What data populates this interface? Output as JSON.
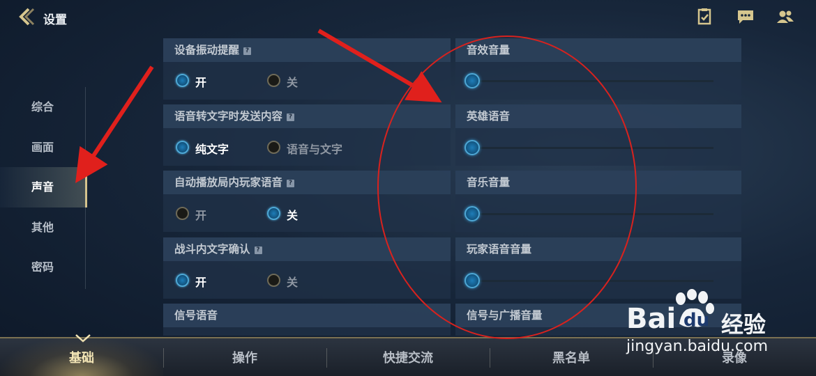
{
  "header": {
    "title": "设置"
  },
  "sidebar": {
    "items": [
      {
        "label": "综合"
      },
      {
        "label": "画面"
      },
      {
        "label": "声音"
      },
      {
        "label": "其他"
      },
      {
        "label": "密码"
      }
    ],
    "active_index": 2
  },
  "left_settings": [
    {
      "title": "设备振动提醒",
      "options": [
        "开",
        "关"
      ],
      "selected": 0
    },
    {
      "title": "语音转文字时发送内容",
      "options": [
        "纯文字",
        "语音与文字"
      ],
      "selected": 0
    },
    {
      "title": "自动播放局内玩家语音",
      "options": [
        "开",
        "关"
      ],
      "selected": 1
    },
    {
      "title": "战斗内文字确认",
      "options": [
        "开",
        "关"
      ],
      "selected": 0
    },
    {
      "title": "信号语音"
    }
  ],
  "right_settings": [
    {
      "title": "音效音量",
      "level": 0
    },
    {
      "title": "英雄语音",
      "level": 0
    },
    {
      "title": "音乐音量",
      "level": 0
    },
    {
      "title": "玩家语音音量",
      "level": 0
    },
    {
      "title": "信号与广播音量"
    }
  ],
  "bottom_tabs": [
    {
      "label": "基础"
    },
    {
      "label": "操作"
    },
    {
      "label": "快捷交流"
    },
    {
      "label": "黑名单"
    },
    {
      "label": "录像"
    }
  ],
  "bottom_active_index": 0,
  "watermark": {
    "brand_left": "Bai",
    "brand_right": "du",
    "product": "经验",
    "url": "jingyan.baidu.com"
  },
  "colors": {
    "accent_blue": "#4ea8d6",
    "gold": "#d8c48a",
    "annotation_red": "#e0201c"
  },
  "icons": [
    "back-chevron-icon",
    "checklist-icon",
    "chat-icon",
    "friends-icon",
    "help-icon",
    "baidu-paw-icon"
  ]
}
